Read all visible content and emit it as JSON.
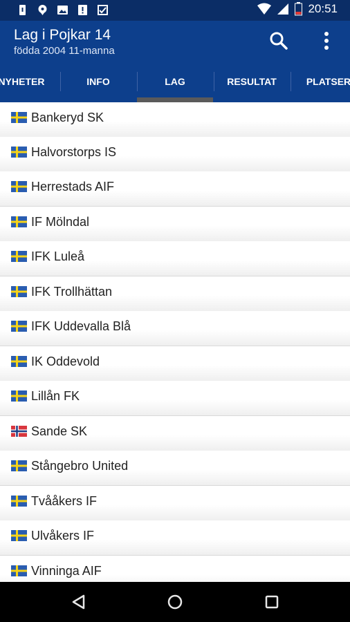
{
  "status_bar": {
    "time": "20:51"
  },
  "app_bar": {
    "title": "Lag i Pojkar 14",
    "subtitle": "födda 2004 11-manna"
  },
  "tabs": [
    {
      "label": "NYHETER"
    },
    {
      "label": "INFO"
    },
    {
      "label": "LAG",
      "selected": true
    },
    {
      "label": "RESULTAT"
    },
    {
      "label": "PLATSER"
    }
  ],
  "teams": [
    {
      "name": "Bankeryd SK",
      "flag": "sweden"
    },
    {
      "name": "Halvorstorps IS",
      "flag": "sweden"
    },
    {
      "name": "Herrestads AIF",
      "flag": "sweden"
    },
    {
      "name": "IF Mölndal",
      "flag": "sweden"
    },
    {
      "name": "IFK Luleå",
      "flag": "sweden"
    },
    {
      "name": "IFK Trollhättan",
      "flag": "sweden"
    },
    {
      "name": "IFK Uddevalla Blå",
      "flag": "sweden"
    },
    {
      "name": "IK Oddevold",
      "flag": "sweden"
    },
    {
      "name": "Lillån FK",
      "flag": "sweden"
    },
    {
      "name": "Sande SK",
      "flag": "norway"
    },
    {
      "name": "Stångebro United",
      "flag": "sweden"
    },
    {
      "name": "Tvååkers IF",
      "flag": "sweden"
    },
    {
      "name": "Ulvåkers IF",
      "flag": "sweden"
    },
    {
      "name": "Vinninga AIF",
      "flag": "sweden"
    }
  ],
  "colors": {
    "status_bar": "#0b2d66",
    "app_bar": "#0d3f8c",
    "tab_indicator": "#5a5a5a"
  }
}
